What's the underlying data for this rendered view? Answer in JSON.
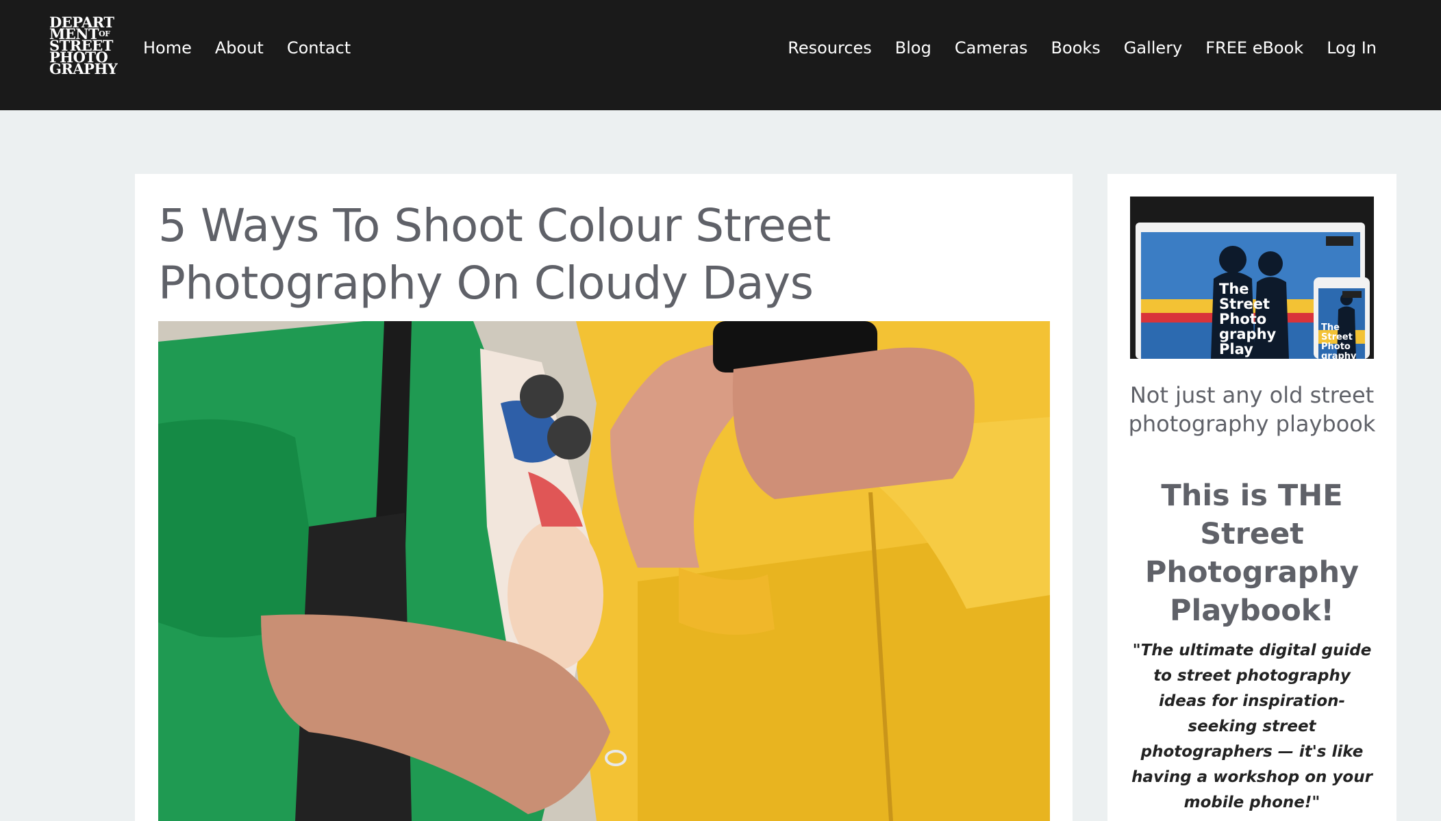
{
  "site": {
    "logo_lines": [
      "DEPART",
      "MENT",
      "OF",
      "STREET",
      "PHOTO",
      "GRAPHY"
    ]
  },
  "nav_left": [
    "Home",
    "About",
    "Contact"
  ],
  "nav_right": [
    "Resources",
    "Blog",
    "Cameras",
    "Books",
    "Gallery",
    "FREE eBook",
    "Log In"
  ],
  "article": {
    "title": "5 Ways To Shoot Colour Street Photography On Cloudy Days"
  },
  "sidebar": {
    "promo_image_lines": [
      "The",
      "Street",
      "Photo",
      "graphy",
      "Play"
    ],
    "promo_image_small_lines": [
      "The",
      "Street",
      "Photo",
      "graphy"
    ],
    "subheading": "Not just any old street photography playbook",
    "heading": "This is THE Street Photography Playbook!",
    "quote": "\"The ultimate digital guide to street photography ideas for inspiration-seeking street photographers — it's like having a workshop on your mobile phone!\""
  },
  "colors": {
    "header_bg": "#1a1a1a",
    "page_bg": "#ecf0f1",
    "title_text": "#5f6168",
    "jacket_green": "#1f9a52",
    "jacket_yellow": "#f3c234"
  }
}
